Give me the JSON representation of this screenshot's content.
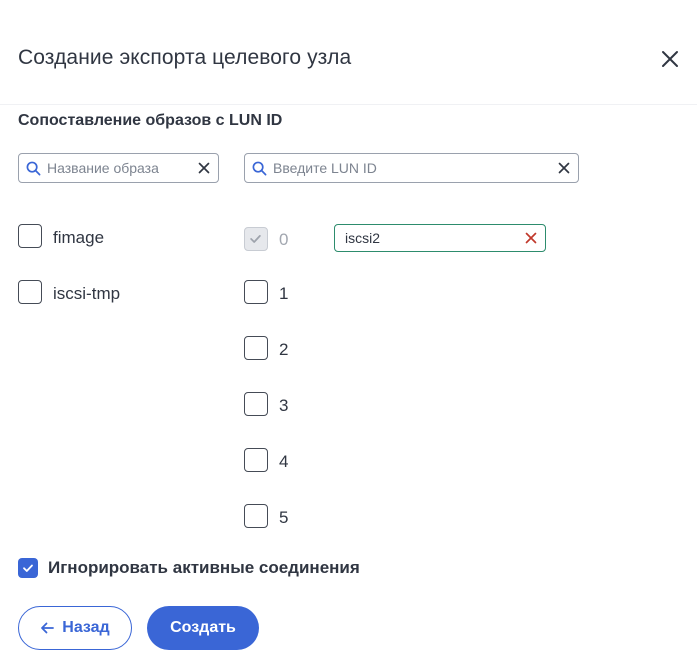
{
  "dialog": {
    "title": "Создание экспорта целевого узла",
    "section_label": "Сопоставление образов с LUN ID"
  },
  "image_search": {
    "placeholder": "Название образа",
    "value": ""
  },
  "lun_search": {
    "placeholder": "Введите LUN ID",
    "value": ""
  },
  "images": [
    {
      "label": "fimage",
      "checked": false
    },
    {
      "label": "iscsi-tmp",
      "checked": false
    }
  ],
  "luns": [
    {
      "id": "0",
      "checked": true,
      "disabled": true,
      "assigned_image": "iscsi2"
    },
    {
      "id": "1",
      "checked": false
    },
    {
      "id": "2",
      "checked": false
    },
    {
      "id": "3",
      "checked": false
    },
    {
      "id": "4",
      "checked": false
    },
    {
      "id": "5",
      "checked": false
    }
  ],
  "options": {
    "ignore_active_connections_label": "Игнорировать активные соединения",
    "ignore_active_connections": true
  },
  "buttons": {
    "back_label": "Назад",
    "create_label": "Создать"
  },
  "colors": {
    "primary": "#3a66d6",
    "text": "#303642",
    "success_border": "#2d8c6d",
    "danger": "#c0392b"
  },
  "icons": {
    "close": "close-icon",
    "search": "search-icon",
    "clear": "clear-icon",
    "back": "arrow-left-icon",
    "check": "check-icon"
  }
}
